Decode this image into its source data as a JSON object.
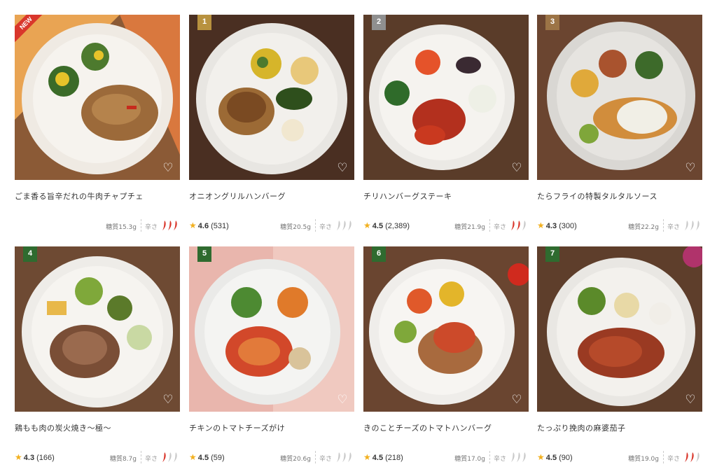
{
  "colors": {
    "rank_gold": "#b8923f",
    "rank_silver": "#8f8f8f",
    "rank_bronze": "#9c7446",
    "rank_green": "#2f6b2f",
    "star": "#f2b01e",
    "pepper_hot": "#d9362b",
    "pepper_off": "#c9c9c9"
  },
  "icons": {
    "favorite": "heart-outline-icon",
    "rating": "star-icon",
    "spice": "chili-pepper-icon"
  },
  "products": [
    {
      "name": "ごま香る旨辛だれの牛肉チャプチェ",
      "badge": "NEW",
      "rank": "",
      "rating": "",
      "reviews": "",
      "sugar": "糖質15.3g",
      "spice_label": "辛さ",
      "spice_level": 3,
      "fav": "♡"
    },
    {
      "name": "オニオングリルハンバーグ",
      "badge": "",
      "rank": "1",
      "rating": "4.6",
      "reviews": "(531)",
      "sugar": "糖質20.5g",
      "spice_label": "辛さ",
      "spice_level": 0,
      "fav": "♡"
    },
    {
      "name": "チリハンバーグステーキ",
      "badge": "",
      "rank": "2",
      "rating": "4.5",
      "reviews": "(2,389)",
      "sugar": "糖質21.9g",
      "spice_label": "辛さ",
      "spice_level": 2,
      "fav": "♡"
    },
    {
      "name": "たらフライの特製タルタルソース",
      "badge": "",
      "rank": "3",
      "rating": "4.3",
      "reviews": "(300)",
      "sugar": "糖質22.2g",
      "spice_label": "辛さ",
      "spice_level": 0,
      "fav": "♡"
    },
    {
      "name": "鶏もも肉の炭火焼き～極～",
      "badge": "",
      "rank": "4",
      "rating": "4.3",
      "reviews": "(166)",
      "sugar": "糖質8.7g",
      "spice_label": "辛さ",
      "spice_level": 1,
      "fav": "♡"
    },
    {
      "name": "チキンのトマトチーズがけ",
      "badge": "",
      "rank": "5",
      "rating": "4.5",
      "reviews": "(59)",
      "sugar": "糖質20.6g",
      "spice_label": "辛さ",
      "spice_level": 0,
      "fav": "♡"
    },
    {
      "name": "きのことチーズのトマトハンバーグ",
      "badge": "",
      "rank": "6",
      "rating": "4.5",
      "reviews": "(218)",
      "sugar": "糖質17.0g",
      "spice_label": "辛さ",
      "spice_level": 0,
      "fav": "♡"
    },
    {
      "name": "たっぷり挽肉の麻婆茄子",
      "badge": "",
      "rank": "7",
      "rating": "4.5",
      "reviews": "(90)",
      "sugar": "糖質19.0g",
      "spice_label": "辛さ",
      "spice_level": 2,
      "fav": "♡"
    }
  ]
}
